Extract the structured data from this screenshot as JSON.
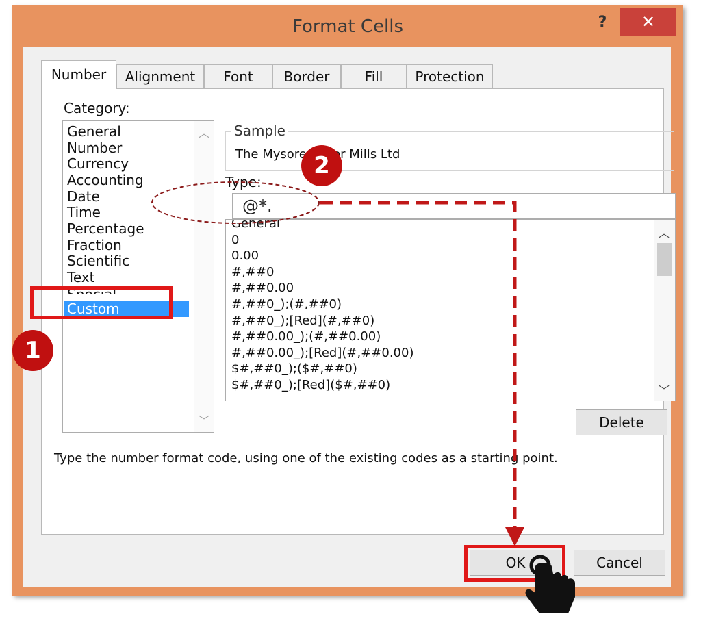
{
  "window": {
    "title": "Format Cells",
    "help_label": "?",
    "close_label": "✕"
  },
  "tabs": [
    {
      "label": "Number",
      "active": true
    },
    {
      "label": "Alignment"
    },
    {
      "label": "Font"
    },
    {
      "label": "Border"
    },
    {
      "label": "Fill"
    },
    {
      "label": "Protection"
    }
  ],
  "category": {
    "label": "Category:",
    "items": [
      "General",
      "Number",
      "Currency",
      "Accounting",
      "Date",
      "Time",
      "Percentage",
      "Fraction",
      "Scientific",
      "Text",
      "Special",
      "Custom"
    ],
    "selected": "Custom"
  },
  "sample": {
    "label": "Sample",
    "value": "The Mysore Paper Mills Ltd"
  },
  "type": {
    "label": "Type:",
    "value": "@*.",
    "formats": [
      "General",
      "0",
      "0.00",
      "#,##0",
      "#,##0.00",
      "#,##0_);(#,##0)",
      "#,##0_);[Red](#,##0)",
      "#,##0.00_);(#,##0.00)",
      "#,##0.00_);[Red](#,##0.00)",
      "$#,##0_);($#,##0)",
      "$#,##0_);[Red]($#,##0)"
    ]
  },
  "buttons": {
    "delete": "Delete",
    "ok": "OK",
    "cancel": "Cancel"
  },
  "hint": "Type the number format code, using one of the existing codes as a starting point.",
  "annotations": {
    "step1": "1",
    "step2": "2"
  },
  "colors": {
    "title_bar": "#e8935f",
    "selection": "#3399ff",
    "highlight": "#e01818",
    "badge": "#c01010",
    "arrow": "#c01818"
  }
}
